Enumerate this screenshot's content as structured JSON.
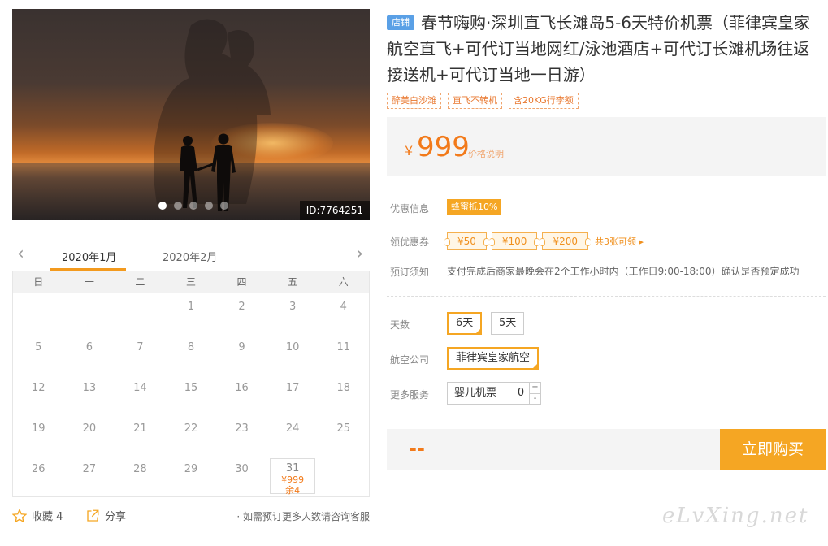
{
  "hero": {
    "id_label": "ID:7764251",
    "dots": 5,
    "active_dot": 0
  },
  "calendar": {
    "months": [
      "2020年1月",
      "2020年2月"
    ],
    "weekdays": [
      "日",
      "一",
      "二",
      "三",
      "四",
      "五",
      "六"
    ],
    "leading_blanks": 3,
    "days_in_month": 31,
    "available": {
      "31": {
        "price": "¥999",
        "left": "余4"
      }
    }
  },
  "bottom": {
    "favorite_label": "收藏 4",
    "share_label": "分享",
    "note": "· 如需预订更多人数请咨询客服"
  },
  "product": {
    "shop_badge": "店铺",
    "title": "春节嗨购·深圳直飞长滩岛5-6天特价机票（菲律宾皇家航空直飞+可代订当地网红/泳池酒店+可代订长滩机场往返接送机+可代订当地一日游）",
    "tags": [
      "醉美白沙滩",
      "直飞不转机",
      "含20KG行李额"
    ],
    "currency": "¥",
    "price": "999",
    "price_explain": "价格说明",
    "promo_label": "优惠信息",
    "promo_value": "蜂蜜抵10%",
    "coupon_label": "领优惠券",
    "coupons": [
      "¥50",
      "¥100",
      "¥200"
    ],
    "coupon_more": "共3张可领 ▸",
    "notice_label": "预订须知",
    "notice_text": "支付完成后商家最晚会在2个工作小时内（工作日9:00-18:00）确认是否预定成功",
    "days_label": "天数",
    "days_options": [
      "6天",
      "5天"
    ],
    "airline_label": "航空公司",
    "airline_value": "菲律宾皇家航空",
    "service_label": "更多服务",
    "service_item": "婴儿机票",
    "service_qty": "0",
    "total": "--",
    "buy_label": "立即购买"
  },
  "watermark": "eLvXing.net"
}
